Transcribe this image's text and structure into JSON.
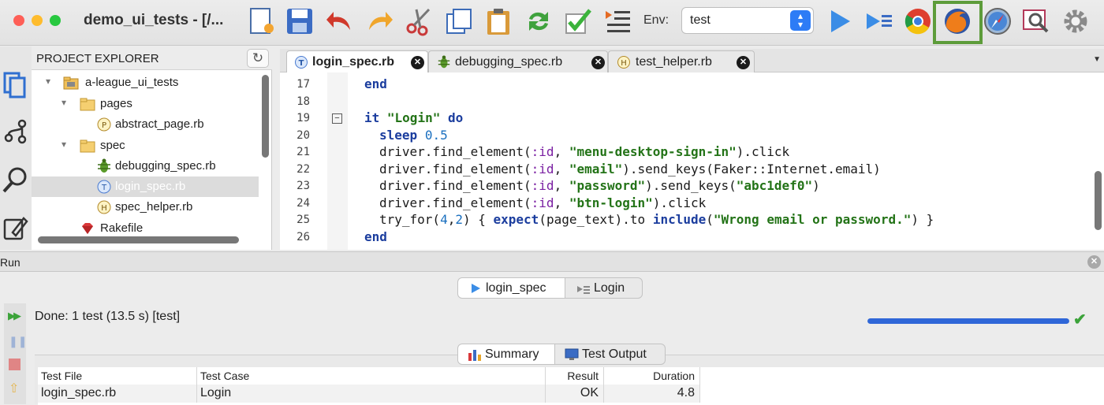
{
  "window": {
    "title": "demo_ui_tests - [/..."
  },
  "toolbar": {
    "env_label": "Env:",
    "env_value": "test",
    "icons": [
      "new-file-icon",
      "save-icon",
      "undo-icon",
      "redo-icon",
      "cut-icon",
      "copy-icon",
      "paste-icon",
      "refresh-icon",
      "validate-icon",
      "outline-icon",
      "run-icon",
      "run-selected-icon",
      "chrome-icon",
      "firefox-icon",
      "safari-icon",
      "inspect-icon",
      "settings-icon"
    ],
    "selected_browser": "firefox"
  },
  "explorer": {
    "title": "PROJECT EXPLORER",
    "items": [
      {
        "label": "a-league_ui_tests",
        "type": "project"
      },
      {
        "label": "pages",
        "type": "folder"
      },
      {
        "label": "abstract_page.rb",
        "type": "page-file"
      },
      {
        "label": "spec",
        "type": "folder"
      },
      {
        "label": "debugging_spec.rb",
        "type": "debug-file"
      },
      {
        "label": "login_spec.rb",
        "type": "test-file",
        "selected": true
      },
      {
        "label": "spec_helper.rb",
        "type": "helper-file"
      },
      {
        "label": "Rakefile",
        "type": "rake-file"
      }
    ]
  },
  "tabs": [
    {
      "label": "login_spec.rb",
      "active": true
    },
    {
      "label": "debugging_spec.rb",
      "active": false
    },
    {
      "label": "test_helper.rb",
      "active": false
    }
  ],
  "editor": {
    "lines": [
      {
        "n": "17",
        "text": "end"
      },
      {
        "n": "18",
        "text": ""
      },
      {
        "n": "19",
        "text": "it \"Login\" do"
      },
      {
        "n": "20",
        "text": "sleep 0.5"
      },
      {
        "n": "21",
        "text": "driver.find_element(:id, \"menu-desktop-sign-in\").click"
      },
      {
        "n": "22",
        "text": "driver.find_element(:id, \"email\").send_keys(Faker::Internet.email)"
      },
      {
        "n": "23",
        "text": "driver.find_element(:id, \"password\").send_keys(\"abc1def0\")"
      },
      {
        "n": "24",
        "text": "driver.find_element(:id, \"btn-login\").click"
      },
      {
        "n": "25",
        "text": "try_for(4,2) { expect(page_text).to include(\"Wrong email or password.\") }"
      },
      {
        "n": "26",
        "text": "end"
      }
    ]
  },
  "run": {
    "panel_title": "Run",
    "view_tabs": [
      "login_spec",
      "Login"
    ],
    "status": "Done: 1 test (13.5 s) [test]",
    "progress": 1.0,
    "result_tabs": [
      "Summary",
      "Test Output"
    ],
    "table": {
      "headers": [
        "Test File",
        "Test Case",
        "Result",
        "Duration"
      ],
      "rows": [
        [
          "login_spec.rb",
          "Login",
          "OK",
          "4.8"
        ]
      ]
    }
  },
  "colors": {
    "accent": "#2d7cf6",
    "progress": "#2f67d8",
    "success": "#3ca33a",
    "highlight": "#5d9c3a"
  }
}
